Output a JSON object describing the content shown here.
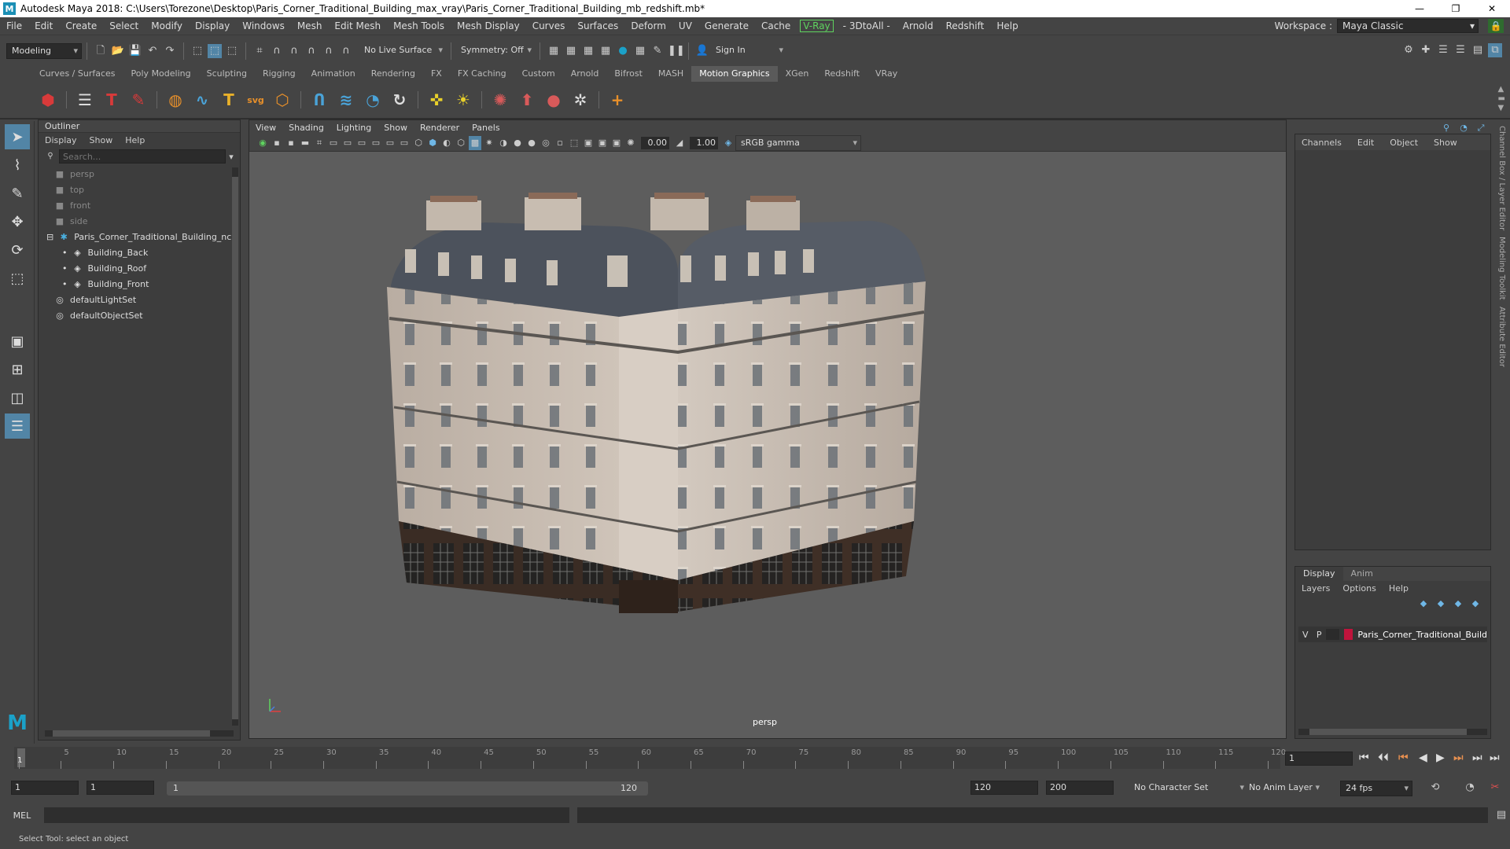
{
  "window": {
    "title": "Autodesk Maya 2018: C:\\Users\\Torezone\\Desktop\\Paris_Corner_Traditional_Building_max_vray\\Paris_Corner_Traditional_Building_mb_redshift.mb*"
  },
  "menubar": {
    "items": [
      "File",
      "Edit",
      "Create",
      "Select",
      "Modify",
      "Display",
      "Windows",
      "Mesh",
      "Edit Mesh",
      "Mesh Tools",
      "Mesh Display",
      "Curves",
      "Surfaces",
      "Deform",
      "UV",
      "Generate",
      "Cache"
    ],
    "vray": "V-Ray",
    "items2": [
      "- 3DtoAll -",
      "Arnold",
      "Redshift",
      "Help"
    ],
    "workspace_label": "Workspace :",
    "workspace_value": "Maya Classic"
  },
  "statusline": {
    "mode": "Modeling",
    "live_surface": "No Live Surface",
    "symmetry": "Symmetry: Off",
    "sign_in": "Sign In"
  },
  "shelf": {
    "tabs": [
      "Curves / Surfaces",
      "Poly Modeling",
      "Sculpting",
      "Rigging",
      "Animation",
      "Rendering",
      "FX",
      "FX Caching",
      "Custom",
      "Arnold",
      "Bifrost",
      "MASH",
      "Motion Graphics",
      "XGen",
      "Redshift",
      "VRay"
    ],
    "active": "Motion Graphics"
  },
  "outliner": {
    "title": "Outliner",
    "menu": [
      "Display",
      "Show",
      "Help"
    ],
    "search_placeholder": "Search...",
    "items": [
      {
        "label": "persp",
        "type": "camera",
        "dim": true,
        "indent": 1
      },
      {
        "label": "top",
        "type": "camera",
        "dim": true,
        "indent": 1
      },
      {
        "label": "front",
        "type": "camera",
        "dim": true,
        "indent": 1
      },
      {
        "label": "side",
        "type": "camera",
        "dim": true,
        "indent": 1
      },
      {
        "label": "Paris_Corner_Traditional_Building_nc",
        "type": "group",
        "dim": false,
        "indent": 0
      },
      {
        "label": "Building_Back",
        "type": "mesh",
        "dim": false,
        "indent": 2
      },
      {
        "label": "Building_Roof",
        "type": "mesh",
        "dim": false,
        "indent": 2
      },
      {
        "label": "Building_Front",
        "type": "mesh",
        "dim": false,
        "indent": 2
      },
      {
        "label": "defaultLightSet",
        "type": "set",
        "dim": false,
        "indent": 1
      },
      {
        "label": "defaultObjectSet",
        "type": "set",
        "dim": false,
        "indent": 1
      }
    ]
  },
  "viewport": {
    "menu": [
      "View",
      "Shading",
      "Lighting",
      "Show",
      "Renderer",
      "Panels"
    ],
    "exposure": "0.00",
    "gamma": "1.00",
    "color_space": "sRGB gamma",
    "camera_label": "persp"
  },
  "channelbox": {
    "menu": [
      "Channels",
      "Edit",
      "Object",
      "Show"
    ]
  },
  "layereditor": {
    "tabs": [
      "Display",
      "Anim"
    ],
    "active_tab": "Display",
    "menu": [
      "Layers",
      "Options",
      "Help"
    ],
    "layer": {
      "v": "V",
      "p": "P",
      "name": "Paris_Corner_Traditional_Build",
      "color": "#c0143c"
    }
  },
  "sidetabs": [
    "Channel Box / Layer Editor",
    "Modeling Toolkit",
    "Attribute Editor"
  ],
  "timeline": {
    "ticks": [
      "5",
      "10",
      "15",
      "20",
      "25",
      "30",
      "35",
      "40",
      "45",
      "50",
      "55",
      "60",
      "65",
      "70",
      "75",
      "80",
      "85",
      "90",
      "95",
      "100",
      "105",
      "110",
      "115",
      "120"
    ],
    "current": "1",
    "current_field": "1"
  },
  "range": {
    "start": "1",
    "playback_start": "1",
    "slider_start": "1",
    "slider_end": "120",
    "playback_end": "120",
    "end": "200",
    "character_set": "No Character Set",
    "anim_layer": "No Anim Layer",
    "fps": "24 fps"
  },
  "cmdline": {
    "label": "MEL"
  },
  "helpline": {
    "text": "Select Tool: select an object"
  }
}
